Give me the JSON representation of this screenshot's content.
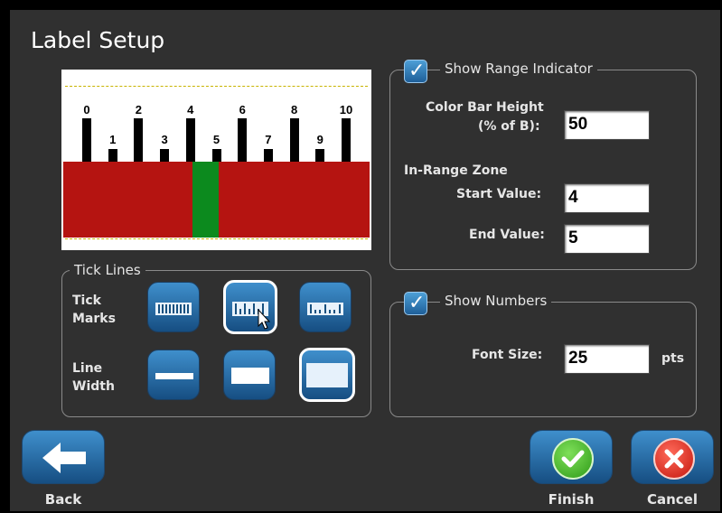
{
  "title": "Label Setup",
  "preview": {
    "tick_labels": [
      "0",
      "1",
      "2",
      "3",
      "4",
      "5",
      "6",
      "7",
      "8",
      "9",
      "10"
    ],
    "colors": {
      "range_bar": "#b51411",
      "in_range_zone": "#0c8a1e"
    }
  },
  "tick_lines": {
    "legend": "Tick Lines",
    "tick_marks_label_1": "Tick",
    "tick_marks_label_2": "Marks",
    "line_width_label_1": "Line",
    "line_width_label_2": "Width"
  },
  "range": {
    "checkbox_label": "Show Range Indicator",
    "color_bar_height_label_1": "Color Bar Height",
    "color_bar_height_label_2": "(% of B):",
    "color_bar_height_value": "50",
    "in_range_zone_label": "In-Range Zone",
    "start_value_label": "Start Value:",
    "start_value": "4",
    "end_value_label": "End Value:",
    "end_value": "5"
  },
  "numbers": {
    "checkbox_label": "Show Numbers",
    "font_size_label": "Font Size:",
    "font_size_value": "25",
    "font_size_unit": "pts"
  },
  "buttons": {
    "back": "Back",
    "finish": "Finish",
    "cancel": "Cancel"
  },
  "icons": {
    "checkmark": "✓",
    "back_icon": "arrow-left",
    "finish_icon": "check-circle",
    "cancel_icon": "x-circle"
  }
}
